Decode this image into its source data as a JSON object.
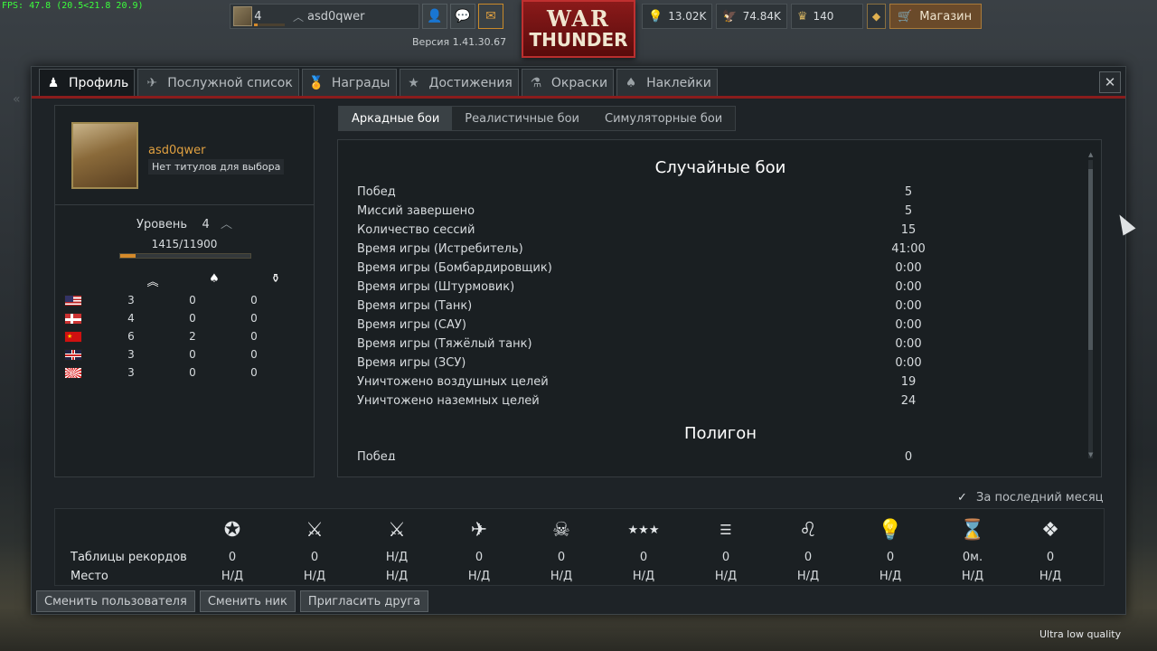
{
  "fps": "FPS: 47.8 (20.5<21.8 20.9)",
  "topbar": {
    "level": "4",
    "nickname": "asd0qwer",
    "version": "Версия 1.41.30.67",
    "logo_line1": "WAR",
    "logo_line2": "THUNDER",
    "lions": "13.02K",
    "eagles": "74.84K",
    "crowns": "140",
    "shop_label": "Магазин",
    "level_progress_pct": 12
  },
  "tabs": [
    {
      "label": "Профиль",
      "icon": "pilot-icon",
      "active": true
    },
    {
      "label": "Послужной список",
      "icon": "crossed-planes-icon",
      "active": false
    },
    {
      "label": "Награды",
      "icon": "medal-icon",
      "active": false
    },
    {
      "label": "Достижения",
      "icon": "star-icon",
      "active": false
    },
    {
      "label": "Окраски",
      "icon": "paint-icon",
      "active": false
    },
    {
      "label": "Наклейки",
      "icon": "decal-icon",
      "active": false
    }
  ],
  "profile": {
    "nickname": "asd0qwer",
    "title": "Нет титулов для выбора",
    "level_label": "Уровень",
    "level": "4",
    "exp": "1415/11900",
    "exp_progress_pct": 12
  },
  "countries": [
    {
      "flag": "usa-flag",
      "a": "3",
      "b": "0",
      "c": "0"
    },
    {
      "flag": "germany-flag",
      "a": "4",
      "b": "0",
      "c": "0"
    },
    {
      "flag": "ussr-flag",
      "a": "6",
      "b": "2",
      "c": "0"
    },
    {
      "flag": "britain-flag",
      "a": "3",
      "b": "0",
      "c": "0"
    },
    {
      "flag": "japan-flag",
      "a": "3",
      "b": "0",
      "c": "0"
    }
  ],
  "mode_tabs": [
    {
      "label": "Аркадные бои",
      "active": true
    },
    {
      "label": "Реалистичные бои",
      "active": false
    },
    {
      "label": "Симуляторные бои",
      "active": false
    }
  ],
  "stats": {
    "section1_title": "Случайные бои",
    "rows": [
      {
        "label": "Побед",
        "value": "5"
      },
      {
        "label": "Миссий завершено",
        "value": "5"
      },
      {
        "label": "Количество сессий",
        "value": "15"
      },
      {
        "label": "Время игры (Истребитель)",
        "value": "41:00"
      },
      {
        "label": "Время игры (Бомбардировщик)",
        "value": "0:00"
      },
      {
        "label": "Время игры (Штурмовик)",
        "value": "0:00"
      },
      {
        "label": "Время игры (Танк)",
        "value": "0:00"
      },
      {
        "label": "Время игры (САУ)",
        "value": "0:00"
      },
      {
        "label": "Время игры (Тяжёлый танк)",
        "value": "0:00"
      },
      {
        "label": "Время игры (ЗСУ)",
        "value": "0:00"
      },
      {
        "label": "Уничтожено воздушных целей",
        "value": "19"
      },
      {
        "label": "Уничтожено наземных целей",
        "value": "24"
      }
    ],
    "section2_title": "Полигон",
    "partial_row": {
      "label": "Побед",
      "value": "0"
    }
  },
  "leaderboard": {
    "month_label": "За последний месяц",
    "icons": [
      "victory-star-icon",
      "crossed-swords-icon",
      "crossed-swords-plane-icon",
      "plane-icon",
      "skull-icon",
      "three-stars-icon",
      "formation-icon",
      "lion-icon",
      "lightbulb-icon",
      "hourglass-icon",
      "diamond-star-icon"
    ],
    "row1_label": "Таблицы рекордов",
    "row1_values": [
      "0",
      "0",
      "Н/Д",
      "0",
      "0",
      "0",
      "0",
      "0",
      "0",
      "0м.",
      "0"
    ],
    "row2_label": "Место",
    "row2_values": [
      "Н/Д",
      "Н/Д",
      "Н/Д",
      "Н/Д",
      "Н/Д",
      "Н/Д",
      "Н/Д",
      "Н/Д",
      "Н/Д",
      "Н/Д",
      "Н/Д"
    ]
  },
  "buttons": {
    "change_user": "Сменить пользователя",
    "change_nick": "Сменить ник",
    "invite_friend": "Пригласить друга"
  },
  "quality": "Ultra low quality"
}
